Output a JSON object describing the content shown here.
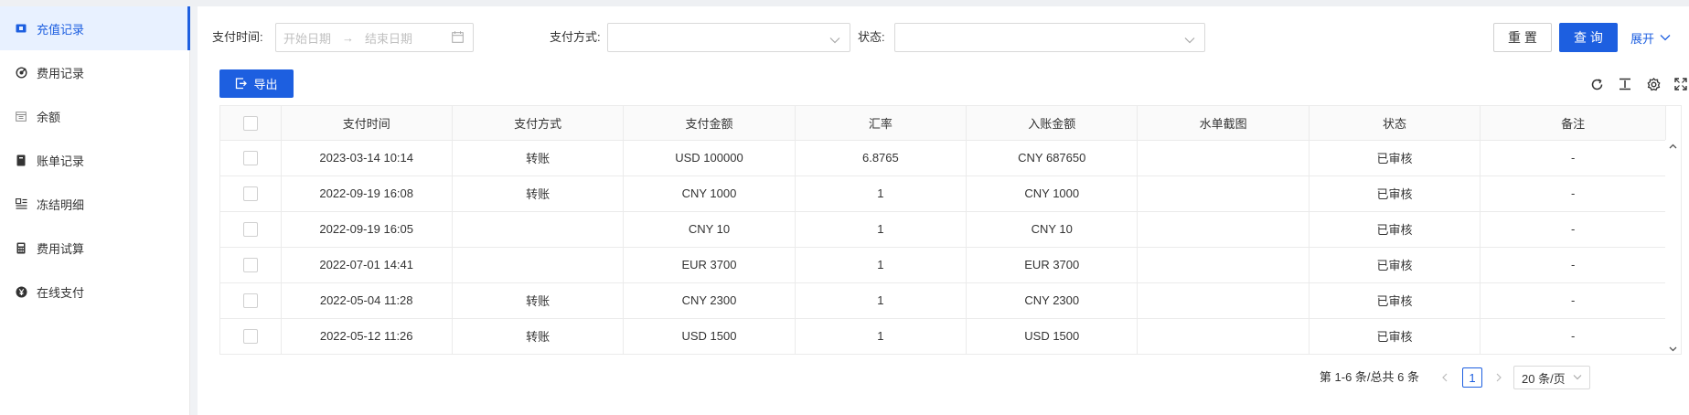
{
  "sidebar": {
    "items": [
      {
        "label": "充值记录",
        "icon": "ticket-icon",
        "active": true
      },
      {
        "label": "费用记录",
        "icon": "target-icon"
      },
      {
        "label": "余额",
        "icon": "calendar-icon"
      },
      {
        "label": "账单记录",
        "icon": "receipt-icon"
      },
      {
        "label": "冻结明细",
        "icon": "list-icon"
      },
      {
        "label": "费用试算",
        "icon": "calculator-icon"
      },
      {
        "label": "在线支付",
        "icon": "yen-icon"
      }
    ]
  },
  "filters": {
    "pay_time_label": "支付时间:",
    "start_placeholder": "开始日期",
    "end_placeholder": "结束日期",
    "pay_method_label": "支付方式:",
    "status_label": "状态:"
  },
  "actions": {
    "reset": "重 置",
    "query": "查 询",
    "expand": "展开",
    "export": "导出"
  },
  "table": {
    "columns": [
      "支付时间",
      "支付方式",
      "支付金额",
      "汇率",
      "入账金额",
      "水单截图",
      "状态",
      "备注"
    ],
    "rows": [
      {
        "time": "2023-03-14 10:14",
        "method": "转账",
        "amount": "USD 100000",
        "rate": "6.8765",
        "credited": "CNY 687650",
        "receipt": "",
        "status": "已审核",
        "note": "-"
      },
      {
        "time": "2022-09-19 16:08",
        "method": "转账",
        "amount": "CNY 1000",
        "rate": "1",
        "credited": "CNY 1000",
        "receipt": "",
        "status": "已审核",
        "note": "-"
      },
      {
        "time": "2022-09-19 16:05",
        "method": "",
        "amount": "CNY 10",
        "rate": "1",
        "credited": "CNY 10",
        "receipt": "",
        "status": "已审核",
        "note": "-"
      },
      {
        "time": "2022-07-01 14:41",
        "method": "",
        "amount": "EUR 3700",
        "rate": "1",
        "credited": "EUR 3700",
        "receipt": "",
        "status": "已审核",
        "note": "-"
      },
      {
        "time": "2022-05-04 11:28",
        "method": "转账",
        "amount": "CNY 2300",
        "rate": "1",
        "credited": "CNY 2300",
        "receipt": "",
        "status": "已审核",
        "note": "-"
      },
      {
        "time": "2022-05-12 11:26",
        "method": "转账",
        "amount": "USD 1500",
        "rate": "1",
        "credited": "USD 1500",
        "receipt": "",
        "status": "已审核",
        "note": "-"
      }
    ]
  },
  "pagination": {
    "total_text": "第 1-6 条/总共 6 条",
    "current_page": "1",
    "page_size": "20 条/页"
  },
  "colors": {
    "accent": "#1d5fe0",
    "active_bg": "#e8f1ff"
  }
}
